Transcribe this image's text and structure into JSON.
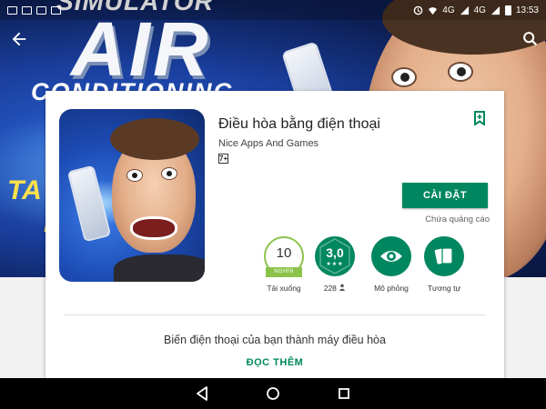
{
  "status_bar": {
    "network_left": "4G",
    "network_right": "4G",
    "time": "13:53"
  },
  "banner": {
    "line_top": "SIMULATOR",
    "line_main": "AIR",
    "line_bottom": "CONDITIONING",
    "side_text_1": "TA",
    "side_text_2": "I"
  },
  "app": {
    "title": "Điều hòa bằng điện thoại",
    "developer": "Nice Apps And Games",
    "content_rating": "7+",
    "install_label": "CÀI ĐẶT",
    "ads_note": "Chứa quảng cáo"
  },
  "stats": {
    "downloads_value": "10",
    "downloads_unit": "NGHÌN",
    "downloads_label": "Tải xuống",
    "rating_value": "3,0",
    "rating_stars": "★★★",
    "rating_count": "228",
    "simulation_label": "Mô phỏng",
    "similar_label": "Tương tự"
  },
  "description": {
    "text": "Biến điện thoại của bạn thành máy điều hòa",
    "read_more": "ĐỌC THÊM"
  },
  "colors": {
    "accent": "#01875f",
    "downloads_ring": "#8bc34a"
  }
}
